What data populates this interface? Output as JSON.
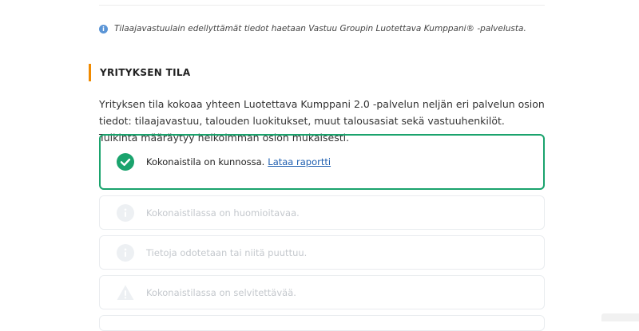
{
  "info_note": "Tilaajavastuulain edellyttämät tiedot haetaan Vastuu Groupin Luotettava Kumppani® -palvelusta.",
  "section": {
    "title": "YRITYKSEN TILA",
    "description": "Yrityksen tila kokoaa yhteen Luotettava Kumppani 2.0 -palvelun neljän eri palvelun osion tiedot: tilaajavastuu, talouden luokitukset, muut talousasiat sekä vastuuhenkilöt. Tulkinta määräytyy heikoimman osion mukaisesti."
  },
  "status_cards": [
    {
      "icon": "check-circle-icon",
      "text": "Kokonaistila on kunnossa.",
      "link": "Lataa raportti",
      "active": true,
      "color": "#1aa36d"
    },
    {
      "icon": "info-circle-icon",
      "text": "Kokonaistilassa on huomioitavaa.",
      "active": false
    },
    {
      "icon": "info-circle-icon",
      "text": "Tietoja odotetaan tai niitä puuttuu.",
      "active": false
    },
    {
      "icon": "warning-triangle-icon",
      "text": "Kokonaistilassa on selvitettävää.",
      "active": false
    }
  ],
  "colors": {
    "accent": "#f08a00",
    "success": "#1aa36d",
    "link": "#1f5fb0"
  }
}
